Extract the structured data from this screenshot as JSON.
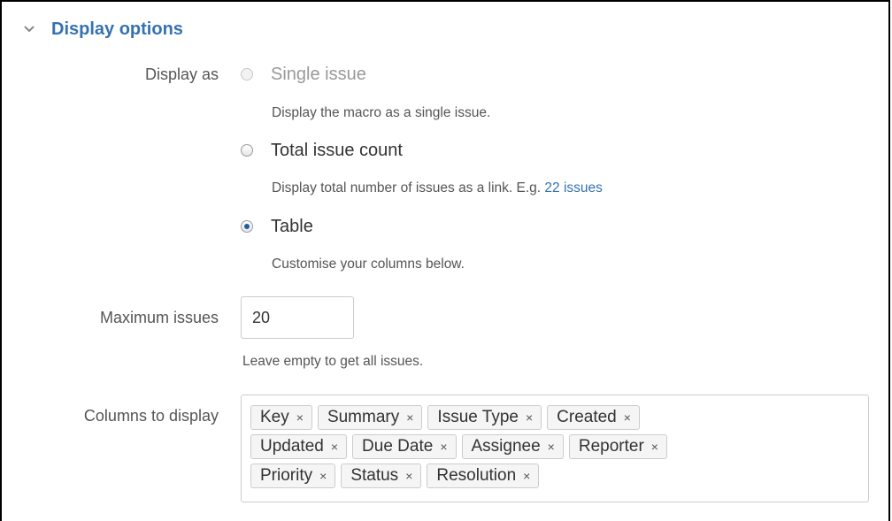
{
  "section": {
    "title": "Display options"
  },
  "display_as": {
    "label": "Display as",
    "options": [
      {
        "label": "Single issue",
        "description": "Display the macro as a single issue.",
        "state": "disabled"
      },
      {
        "label": "Total issue count",
        "description": "Display total number of issues as a link. E.g. ",
        "link_text": "22 issues",
        "state": "unchecked"
      },
      {
        "label": "Table",
        "description": "Customise your columns below.",
        "state": "checked"
      }
    ]
  },
  "maximum_issues": {
    "label": "Maximum issues",
    "value": "20",
    "help": "Leave empty to get all issues."
  },
  "columns": {
    "label": "Columns to display",
    "remove_glyph": "×",
    "rows": [
      [
        "Key",
        "Summary",
        "Issue Type",
        "Created"
      ],
      [
        "Updated",
        "Due Date",
        "Assignee",
        "Reporter"
      ],
      [
        "Priority",
        "Status",
        "Resolution"
      ]
    ]
  },
  "colors": {
    "accent": "#3572b0",
    "text": "#333333",
    "muted": "#555555"
  }
}
